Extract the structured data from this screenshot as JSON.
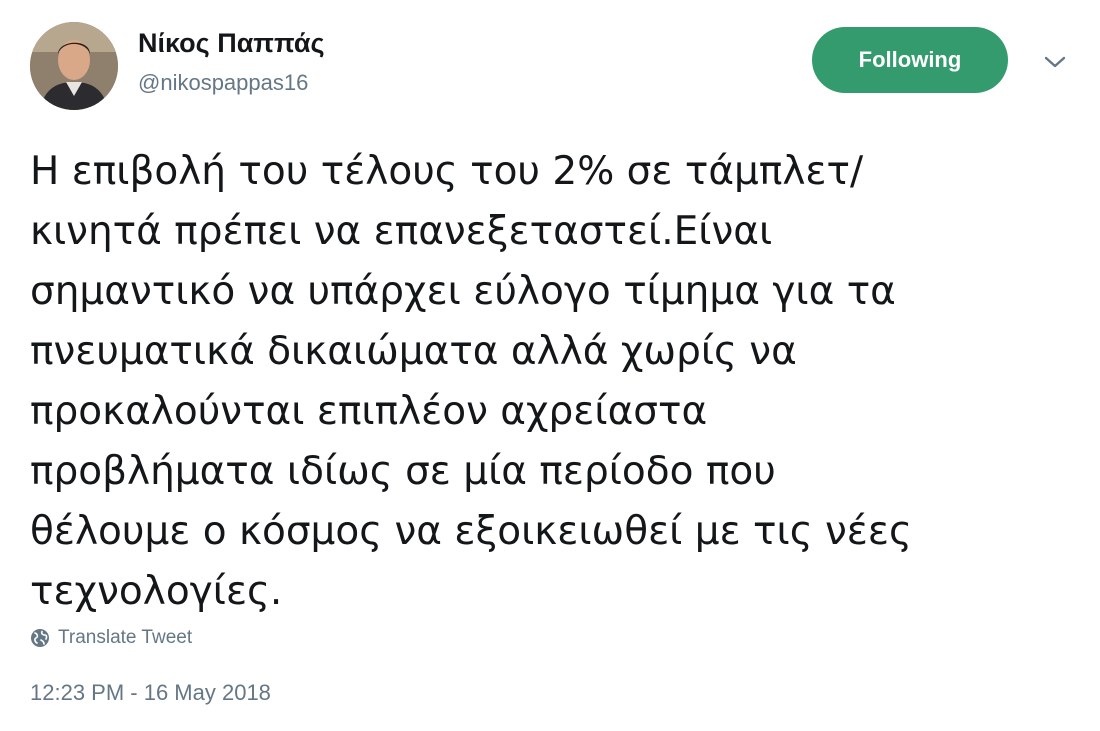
{
  "author": {
    "display_name": "Νίκος Παππάς",
    "handle": "@nikospappas16"
  },
  "follow_button": {
    "label": "Following",
    "color": "#349b6e"
  },
  "tweet": {
    "lines": [
      "Η επιβολή του τέλους του 2% σε τάμπλετ/",
      "κινητά πρέπει να επανεξεταστεί.Είναι",
      "σημαντικό να υπάρχει εύλογο τίμημα για τα",
      "πνευματικά δικαιώματα αλλά χωρίς να",
      "προκαλούνται επιπλέον αχρείαστα",
      "προβλήματα ιδίως σε μία περίοδο που",
      "θέλουμε ο κόσμος να εξοικειωθεί με τις νέες",
      "τεχνολογίες."
    ],
    "translate_label": "Translate Tweet",
    "timestamp": "12:23 PM - 16 May 2018"
  },
  "icons": {
    "avatar": "profile-photo",
    "caret": "chevron-down-icon",
    "translate": "globe-icon"
  },
  "colors": {
    "text_primary": "#14171a",
    "text_secondary": "#657786",
    "accent_green": "#349b6e"
  }
}
